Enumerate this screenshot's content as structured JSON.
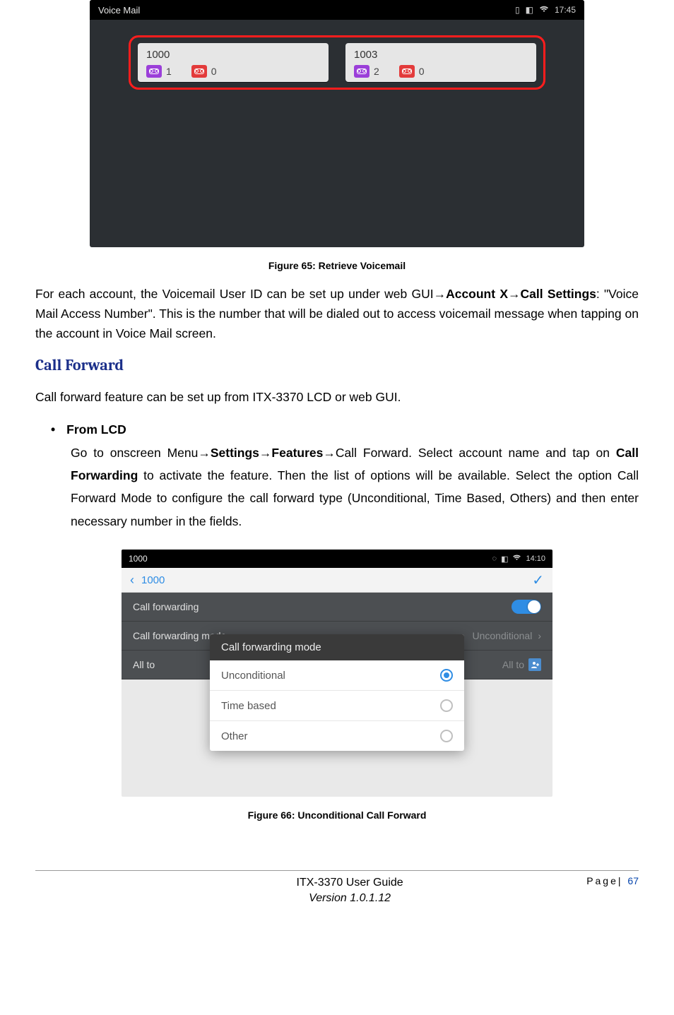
{
  "fig65": {
    "statusbar": {
      "title": "Voice Mail",
      "time": "17:45"
    },
    "accounts": [
      {
        "name": "1000",
        "new": "1",
        "old": "0"
      },
      {
        "name": "1003",
        "new": "2",
        "old": "0"
      }
    ],
    "caption": "Figure 65: Retrieve Voicemail"
  },
  "para1": {
    "a": "For each account, the Voicemail User ID can be set up under web GUI",
    "b": "Account X",
    "c": "Call Settings",
    "d": ": \"Voice Mail Access Number\". This is the number that will be dialed out to access voicemail message when tapping on the account in Voice Mail screen."
  },
  "heading_callforward": "Call Forward",
  "para2": "Call forward feature can be set up from ITX-3370 LCD or web GUI.",
  "bullet1": {
    "title": "From LCD",
    "seg1": "Go to onscreen Menu",
    "seg2": "Settings",
    "seg3": "Features",
    "seg4": "Call Forward. Select account name and tap on ",
    "seg5": "Call Forwarding",
    "seg6": " to activate the feature. Then the list of options will be available. Select the option Call Forward Mode to configure the call forward type (Unconditional, Time Based, Others) and then enter necessary number in the fields."
  },
  "fig66": {
    "statusbar": {
      "title": "1000",
      "time": "14:10"
    },
    "subbar": {
      "back": "1000"
    },
    "rows": {
      "forwarding": "Call forwarding",
      "mode_label": "Call forwarding mode",
      "mode_value": "Unconditional",
      "allto_label": "All to",
      "allto_value": "All to"
    },
    "overlay": {
      "title": "Call forwarding mode",
      "options": [
        "Unconditional",
        "Time based",
        "Other"
      ]
    },
    "caption": "Figure 66: Unconditional Call Forward"
  },
  "footer": {
    "guide": "ITX-3370 User Guide",
    "version": "Version 1.0.1.12",
    "page_label": "Page|",
    "page_num": "67"
  },
  "arrow": "→"
}
